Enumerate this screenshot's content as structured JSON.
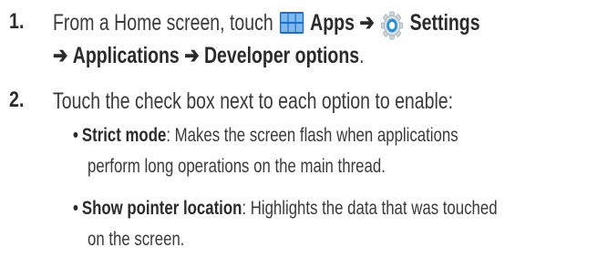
{
  "steps": [
    {
      "number": "1.",
      "line1": {
        "prefix": "From a Home screen, touch",
        "apps_label": "Apps",
        "arrow1": "➔",
        "settings_label": "Settings"
      },
      "line2": {
        "arrow_a": "➔",
        "applications_label": "Applications",
        "arrow_b": "➔",
        "developer_label": "Developer options",
        "period": "."
      }
    },
    {
      "number": "2.",
      "text": "Touch the check box next to each option to enable:",
      "options": [
        {
          "bullet": "•",
          "term": "Strict mode",
          "desc_line1": ": Makes the screen flash when applications",
          "desc_line2": "perform long operations on the main thread."
        },
        {
          "bullet": "•",
          "term": "Show pointer location",
          "desc_line1": ": Highlights the data that was touched",
          "desc_line2": "on the screen."
        }
      ]
    }
  ],
  "icons": {
    "apps": "apps-grid-icon",
    "settings": "settings-gear-icon",
    "apps_color": "#1e6fc4",
    "settings_color": "#2c8fd6"
  }
}
